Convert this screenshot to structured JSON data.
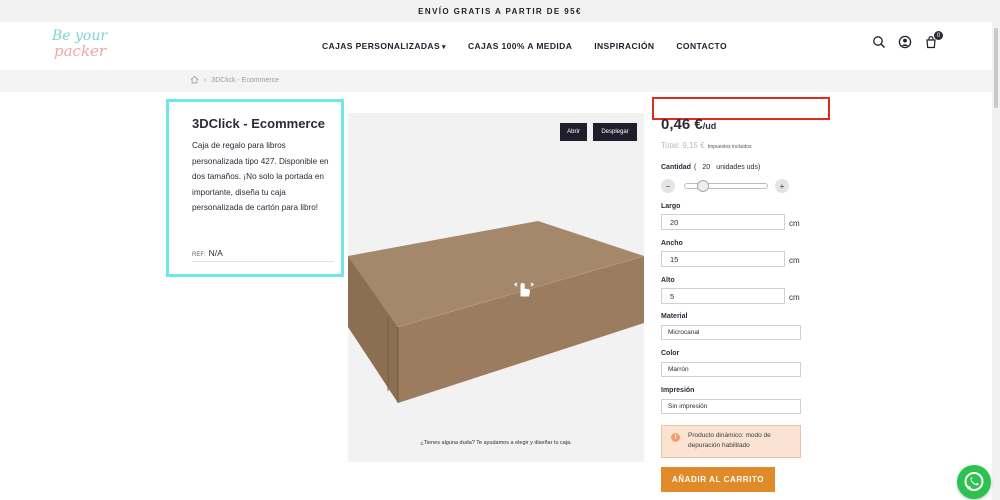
{
  "announcement": "ENVÍO GRATIS A PARTIR DE 95€",
  "logo": {
    "line1": "Be your",
    "line2": "packer"
  },
  "nav": [
    {
      "label": "CAJAS PERSONALIZADAS",
      "has_dropdown": true
    },
    {
      "label": "CAJAS 100% A MEDIDA"
    },
    {
      "label": "INSPIRACIÓN"
    },
    {
      "label": "CONTACTO"
    }
  ],
  "header_icons": [
    "search-icon",
    "user-icon",
    "cart-icon"
  ],
  "cart_count": "0",
  "breadcrumb": {
    "current": "3DClick - Ecommerce"
  },
  "product": {
    "title": "3DClick - Ecommerce",
    "description": "Caja de regalo para libros personalizada tipo 427. Disponible en dos tamaños. ¡No solo la portada en importante, diseña tu caja personalizada de cartón para libro!",
    "ref_label": "REF:",
    "ref_value": "N/A"
  },
  "viewer": {
    "open_label": "Abrir",
    "unfold_label": "Desplegar",
    "help_text": "¿Tienes alguna duda? Te ayudamos a elegir y diseñar tu caja."
  },
  "pricing": {
    "unit_price": "0,46 €",
    "unit_suffix": "/ud",
    "total_label": "Total: 9,15 €",
    "tax_note": "Impuestos incluidos"
  },
  "quantity": {
    "label": "Cantidad",
    "open_paren": "(",
    "value": "20",
    "unit": "unidades uds)",
    "slider_fraction": 0.18
  },
  "dimensions": {
    "largo": {
      "label": "Largo",
      "value": "20",
      "unit": "cm"
    },
    "ancho": {
      "label": "Ancho",
      "value": "15",
      "unit": "cm"
    },
    "alto": {
      "label": "Alto",
      "value": "5",
      "unit": "cm"
    }
  },
  "options": {
    "material": {
      "label": "Material",
      "value": "Microcanal"
    },
    "color": {
      "label": "Color",
      "value": "Marrón"
    },
    "impresion": {
      "label": "Impresión",
      "value": "Sin impresión"
    }
  },
  "notice": "Producto dinámico: modo de depuración habilitado",
  "add_to_cart": "AÑADIR AL CARRITO",
  "colors": {
    "info_border": "#6fe6ea",
    "highlight_red": "#e02a20",
    "cart_button": "#e08a2a",
    "notice_bg": "#fbe3d4",
    "whatsapp": "#2bc24f",
    "box_brown": "#9b7c5f"
  }
}
